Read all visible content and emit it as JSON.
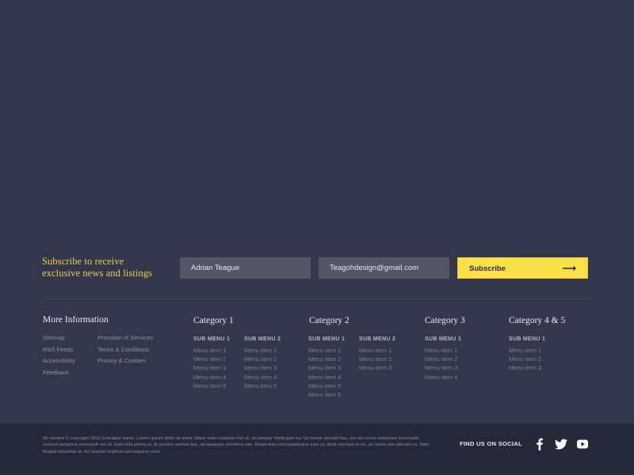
{
  "subscribe": {
    "heading_line1": "Subscribe to receive",
    "heading_line2": "exclusive news and listings",
    "name_value": "Adrian Teague",
    "email_value": "Teagohdesign@gmail.com",
    "button_label": "Subscribe",
    "button_icon": "arrow-right-icon",
    "accent_color": "#fce04a"
  },
  "more_info": {
    "title": "More Information",
    "left_links": [
      "Sitemap",
      "RSS Feeds",
      "Accessibility",
      "Feedback"
    ],
    "right_links": [
      "Provision of Services",
      "Terms & Conditions",
      "Privacy & Cookies"
    ]
  },
  "categories": [
    {
      "title": "Category 1",
      "submenus": [
        {
          "title": "SUB MENU 1",
          "items": [
            "Menu item 1",
            "Menu item 2",
            "Menu item 3",
            "Menu item 4",
            "Menu item 5"
          ]
        },
        {
          "title": "SUB MENU 2",
          "items": [
            "Menu item 1",
            "Menu item 2",
            "Menu item 3",
            "Menu item 4",
            "Menu item 5"
          ]
        }
      ]
    },
    {
      "title": "Category 2",
      "submenus": [
        {
          "title": "SUB MENU 1",
          "items": [
            "Menu item 1",
            "Menu item 2",
            "Menu item 3",
            "Menu item 4",
            "Menu item 5",
            "Menu item 6"
          ]
        },
        {
          "title": "SUB MENU 2",
          "items": [
            "Menu item 1",
            "Menu item 2",
            "Menu item 3"
          ]
        }
      ]
    },
    {
      "title": "Category 3",
      "submenus": [
        {
          "title": "SUB MENU 1",
          "items": [
            "Menu item 1",
            "Menu item 2",
            "Menu item 3",
            "Menu item 4"
          ]
        }
      ]
    },
    {
      "title": "Category 4 & 5",
      "submenus": [
        {
          "title": "SUB MENU 1",
          "items": [
            "Menu item 1",
            "Menu item 2",
            "Menu item 3"
          ]
        }
      ]
    }
  ],
  "footer": {
    "copyright": "All content © copyright 2016 Comapny name. Lorem ipsum dolor sit amet, idque inani noluisse mel ut, sit semper intellegam eu. Ut verear percipit has, pro ad omnis maluisset incorrupte, nostrud perpetua corrumpit nec et. Eam tota prima cu, te possim animal quo, ad quaeque erroribus nec. Dissentias concludaturque eam ut, dicat omnium ei vix, pri sumo sint alterum cu. Nam feugiat urbanitas id. Ad quando explicari persequeris eum.",
    "social_label": "FIND US ON SOCIAL",
    "social_icons": [
      "facebook-icon",
      "twitter-icon",
      "youtube-icon"
    ]
  }
}
